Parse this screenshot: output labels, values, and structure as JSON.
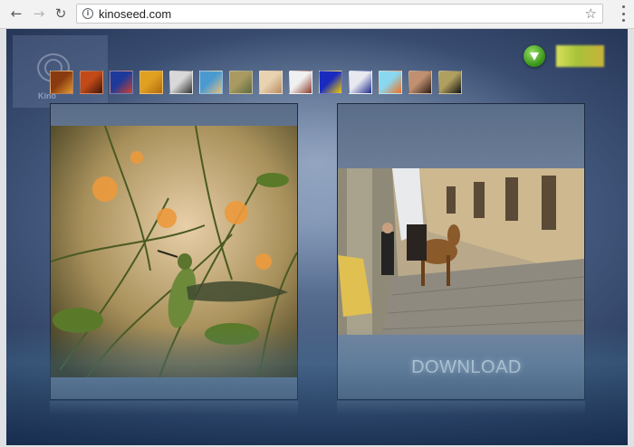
{
  "browser": {
    "url": "kinoseed.com",
    "icons": {
      "back": "back-arrow-icon",
      "forward": "forward-arrow-icon",
      "reload": "reload-icon",
      "info": "info-icon",
      "bookmark": "star-icon",
      "menu": "kebab-menu-icon"
    },
    "glyphs": {
      "back": "←",
      "forward": "→",
      "reload": "↻",
      "info": "i",
      "star": "☆"
    }
  },
  "page": {
    "logo_text": "Kino",
    "download_label": "DOWNLOAD",
    "thumbnails": [
      {
        "label": "thumb-1",
        "colors": [
          "#8a3a10",
          "#e09a30"
        ]
      },
      {
        "label": "thumb-2",
        "colors": [
          "#c24a18",
          "#3a1608"
        ]
      },
      {
        "label": "thumb-3",
        "colors": [
          "#1d3a9a",
          "#d0402a"
        ]
      },
      {
        "label": "thumb-4",
        "colors": [
          "#e0a020",
          "#b06a10"
        ]
      },
      {
        "label": "thumb-5",
        "colors": [
          "#d8d8d8",
          "#303030"
        ]
      },
      {
        "label": "thumb-6",
        "colors": [
          "#4a9ad0",
          "#e8c080"
        ]
      },
      {
        "label": "thumb-7",
        "colors": [
          "#a89a60",
          "#5a6a40"
        ]
      },
      {
        "label": "thumb-8",
        "colors": [
          "#e8d2b0",
          "#b88a60"
        ]
      },
      {
        "label": "thumb-9",
        "colors": [
          "#f0f0f0",
          "#8a3a2a"
        ]
      },
      {
        "label": "thumb-10",
        "colors": [
          "#1a2abf",
          "#f2d000"
        ]
      },
      {
        "label": "thumb-11",
        "colors": [
          "#e8e8f0",
          "#1a2a8a"
        ]
      },
      {
        "label": "thumb-12",
        "colors": [
          "#8ad8f0",
          "#f07020"
        ]
      },
      {
        "label": "thumb-13",
        "colors": [
          "#c09070",
          "#2a1a14"
        ]
      },
      {
        "label": "thumb-14",
        "colors": [
          "#b0a060",
          "#101010"
        ]
      }
    ],
    "colors": {
      "accent_green": "#3f9a1e",
      "panel_border": "#1e2b40"
    }
  }
}
